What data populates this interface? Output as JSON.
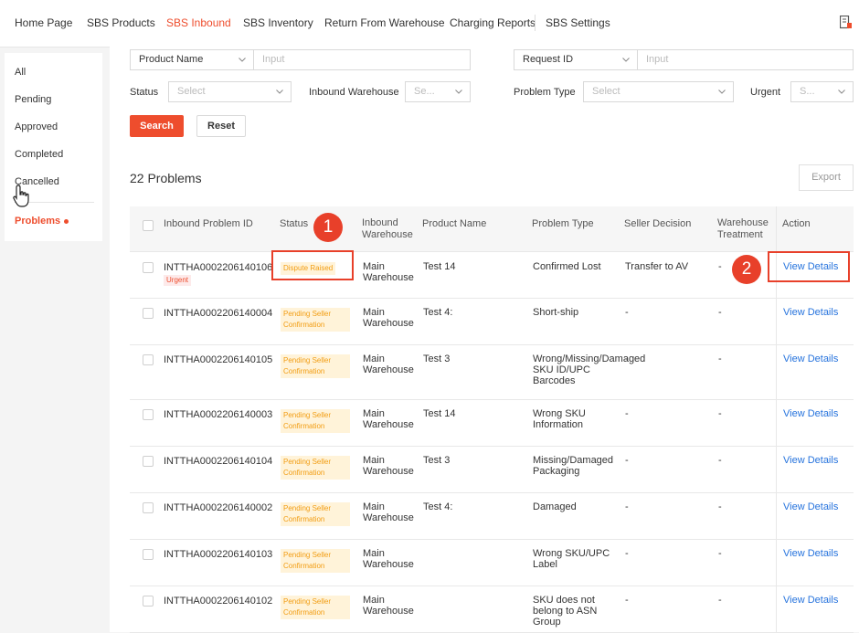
{
  "topnav": {
    "tabs": [
      "Home Page",
      "SBS Products",
      "SBS Inbound",
      "SBS Inventory",
      "Return From Warehouse",
      "Charging Reports",
      "SBS Settings"
    ],
    "active_index": 2
  },
  "sidebar": {
    "items": [
      "All",
      "Pending",
      "Approved",
      "Completed",
      "Cancelled"
    ],
    "active_item": "Problems"
  },
  "filters": {
    "search_by_select": "Product Name",
    "search_by_placeholder": "Input",
    "request_select": "Request ID",
    "request_placeholder": "Input",
    "status_label": "Status",
    "status_placeholder": "Select",
    "warehouse_label": "Inbound Warehouse",
    "warehouse_placeholder": "Se...",
    "problem_type_label": "Problem Type",
    "problem_type_placeholder": "Select",
    "urgent_label": "Urgent",
    "urgent_placeholder": "S...",
    "search_button": "Search",
    "reset_button": "Reset"
  },
  "results": {
    "count_text": "22 Problems",
    "export_button": "Export"
  },
  "table": {
    "headers": [
      "Inbound Problem ID",
      "Status",
      "Inbound Warehouse",
      "Product Name",
      "Problem Type",
      "Seller Decision",
      "Warehouse Treatment",
      "Action"
    ],
    "urgent_tag": "Urgent",
    "action_label": "View Details",
    "rows": [
      {
        "id": "INTTHA0002206140106",
        "urgent": true,
        "status": "Dispute Raised",
        "warehouse": "Main Warehouse",
        "product": "Test 14",
        "problem": "Confirmed Lost",
        "decision": "Transfer to AV",
        "treatment": "-"
      },
      {
        "id": "INTTHA0002206140004",
        "urgent": false,
        "status": "Pending Seller Confirmation",
        "warehouse": "Main Warehouse",
        "product": "Test 4:",
        "problem": "Short-ship",
        "decision": "-",
        "treatment": "-"
      },
      {
        "id": "INTTHA0002206140105",
        "urgent": false,
        "status": "Pending Seller Confirmation",
        "warehouse": "Main Warehouse",
        "product": "Test 3",
        "problem": "Wrong/Missing/Damaged SKU ID/UPC Barcodes",
        "decision": "-",
        "treatment": "-"
      },
      {
        "id": "INTTHA0002206140003",
        "urgent": false,
        "status": "Pending Seller Confirmation",
        "warehouse": "Main Warehouse",
        "product": "Test 14",
        "problem": "Wrong SKU Information",
        "decision": "-",
        "treatment": "-"
      },
      {
        "id": "INTTHA0002206140104",
        "urgent": false,
        "status": "Pending Seller Confirmation",
        "warehouse": "Main Warehouse",
        "product": "Test 3",
        "problem": "Missing/Damaged Packaging",
        "decision": "-",
        "treatment": "-"
      },
      {
        "id": "INTTHA0002206140002",
        "urgent": false,
        "status": "Pending Seller Confirmation",
        "warehouse": "Main Warehouse",
        "product": "Test 4:",
        "problem": "Damaged",
        "decision": "-",
        "treatment": "-"
      },
      {
        "id": "INTTHA0002206140103",
        "urgent": false,
        "status": "Pending Seller Confirmation",
        "warehouse": "Main Warehouse",
        "product": "",
        "problem": "Wrong SKU/UPC Label",
        "decision": "-",
        "treatment": "-"
      },
      {
        "id": "INTTHA0002206140102",
        "urgent": false,
        "status": "Pending Seller Confirmation",
        "warehouse": "Main Warehouse",
        "product": "",
        "problem": "SKU does not belong to ASN Group",
        "decision": "-",
        "treatment": "-"
      }
    ]
  },
  "annotations": [
    "1",
    "2"
  ],
  "colors": {
    "accent": "#ee4d2d",
    "link": "#2673dd",
    "badge_text": "#f29d12",
    "badge_bg": "#fff3d9",
    "annotation": "#e8402a"
  }
}
